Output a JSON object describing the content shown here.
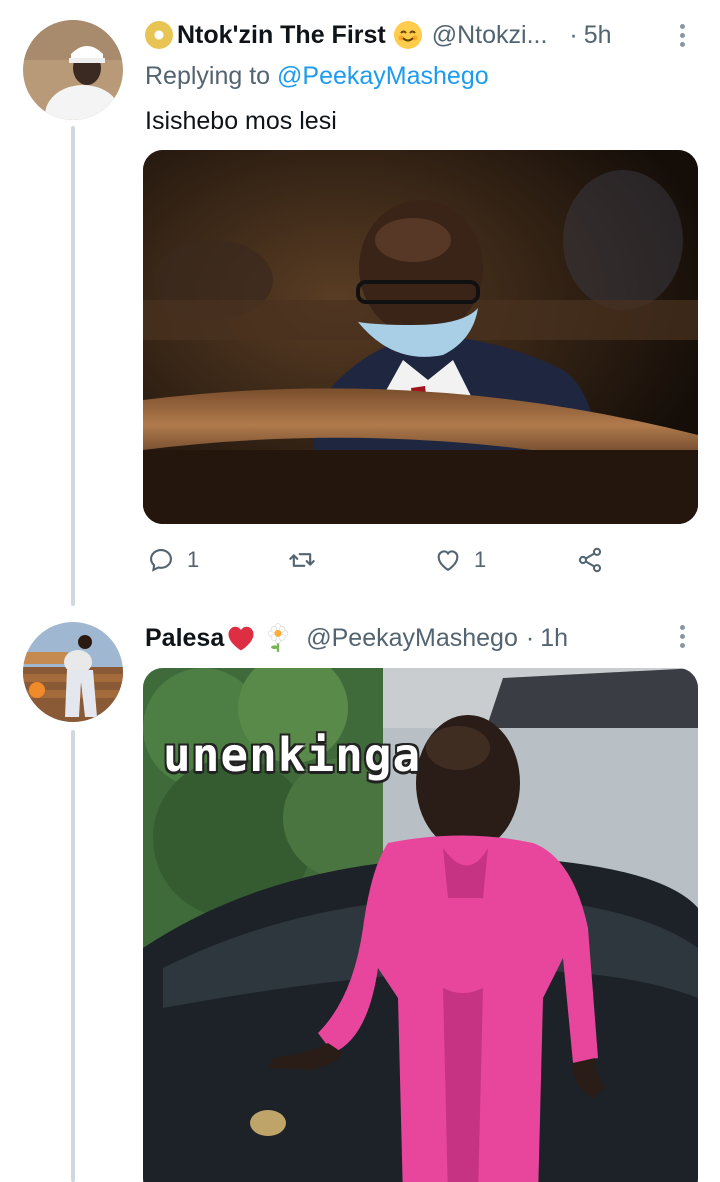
{
  "tweets": [
    {
      "display_name": "Ntok'zin The First",
      "handle": "@Ntokzi...",
      "time": "5h",
      "replying_prefix": "Replying to ",
      "replying_to": "@PeekayMashego",
      "text": "Isishebo mos lesi",
      "reply_count": "1",
      "like_count": "1"
    },
    {
      "display_name": "Palesa",
      "handle": "@PeekayMashego",
      "time": "1h",
      "image_caption": "unenkinga"
    }
  ],
  "icons": {
    "reply": "reply-icon",
    "retweet": "retweet-icon",
    "like": "heart-icon",
    "share": "share-icon",
    "more": "more-icon"
  },
  "colors": {
    "link": "#1d9bf0",
    "secondary_text": "#536471",
    "thread_line": "#cfd9de"
  }
}
